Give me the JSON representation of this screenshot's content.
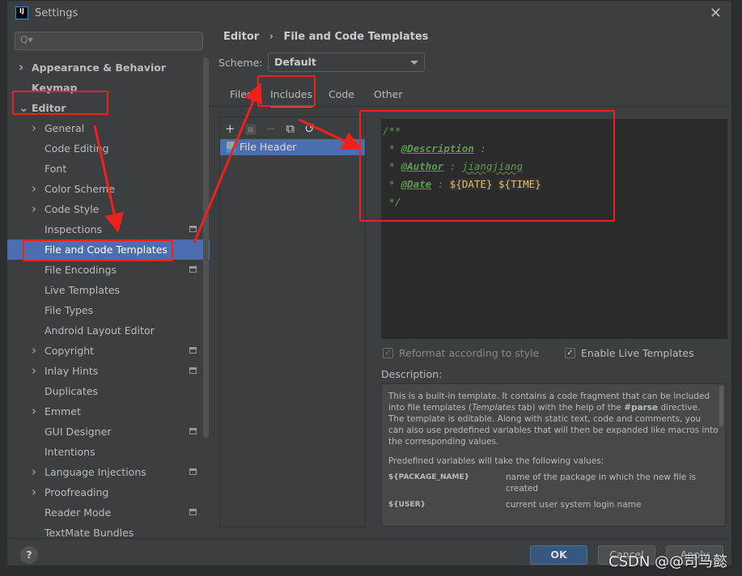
{
  "window": {
    "title": "Settings"
  },
  "search": {
    "placeholder": "Q▾"
  },
  "sidebar": {
    "items": [
      {
        "label": "Appearance & Behavior",
        "arrow": ">",
        "bold": true,
        "level": 0
      },
      {
        "label": "Keymap",
        "bold": true,
        "level": 0
      },
      {
        "label": "Editor",
        "arrow": "v",
        "bold": true,
        "level": 0
      },
      {
        "label": "General",
        "arrow": ">",
        "level": 1
      },
      {
        "label": "Code Editing",
        "level": 1
      },
      {
        "label": "Font",
        "level": 1
      },
      {
        "label": "Color Scheme",
        "arrow": ">",
        "level": 1
      },
      {
        "label": "Code Style",
        "arrow": ">",
        "level": 1
      },
      {
        "label": "Inspections",
        "level": 1,
        "badge": true
      },
      {
        "label": "File and Code Templates",
        "level": 1,
        "selected": true
      },
      {
        "label": "File Encodings",
        "level": 1,
        "badge": true
      },
      {
        "label": "Live Templates",
        "level": 1
      },
      {
        "label": "File Types",
        "level": 1
      },
      {
        "label": "Android Layout Editor",
        "level": 1
      },
      {
        "label": "Copyright",
        "arrow": ">",
        "level": 1,
        "badge": true
      },
      {
        "label": "Inlay Hints",
        "arrow": ">",
        "level": 1,
        "badge": true
      },
      {
        "label": "Duplicates",
        "level": 1
      },
      {
        "label": "Emmet",
        "arrow": ">",
        "level": 1
      },
      {
        "label": "GUI Designer",
        "level": 1,
        "badge": true
      },
      {
        "label": "Intentions",
        "level": 1
      },
      {
        "label": "Language Injections",
        "arrow": ">",
        "level": 1,
        "badge": true
      },
      {
        "label": "Proofreading",
        "arrow": ">",
        "level": 1
      },
      {
        "label": "Reader Mode",
        "level": 1,
        "badge": true
      },
      {
        "label": "TextMate Bundles",
        "level": 1
      }
    ]
  },
  "breadcrumb": {
    "parent": "Editor",
    "sep": "›",
    "current": "File and Code Templates"
  },
  "scheme": {
    "label": "Scheme:",
    "value": "Default"
  },
  "tabs": [
    {
      "label": "Files"
    },
    {
      "label": "Includes",
      "active": true
    },
    {
      "label": "Code"
    },
    {
      "label": "Other"
    }
  ],
  "toolbar": {
    "add": "+",
    "copy_icon": "copy-icon",
    "remove": "−",
    "reset": "↺"
  },
  "templates": [
    {
      "name": "File Header"
    }
  ],
  "editor": {
    "lines": {
      "l1": "/**",
      "star": " * ",
      "desc_tag": "@Description",
      "desc_rest": " :",
      "author_tag": "@Author",
      "author_sep": " : ",
      "author_val": "jiangjiang",
      "date_tag": "@Date",
      "date_sep": " : ",
      "var1": "${DATE}",
      "var2": "${TIME}",
      "end": " */"
    }
  },
  "options": {
    "reformat": "Reformat according to style",
    "reformat_checked": true,
    "reformat_disabled": true,
    "live": "Enable Live Templates",
    "live_checked": true
  },
  "description": {
    "label": "Description:",
    "p1a": "This is a built-in template. It contains a code fragment that can be included into file templates (",
    "p1i": "Templates",
    "p1b": " tab) with the help of the ",
    "p1c": "#parse",
    "p1d": " directive.",
    "p2": "The template is editable. Along with static text, code and comments, you can also use predefined variables that will then be expanded like macros into the corresponding values.",
    "p3": "Predefined variables will take the following values:",
    "vars": [
      {
        "key": "${PACKAGE_NAME}",
        "value": "name of the package in which the new file is created"
      },
      {
        "key": "${USER}",
        "value": "current user system login name"
      }
    ]
  },
  "footer": {
    "help": "?",
    "ok": "OK",
    "cancel": "Cancel",
    "apply": "Apply"
  },
  "watermark": "CSDN @@司马懿",
  "colors": {
    "accent": "#4b6eaf",
    "annotation": "#f0201c",
    "comment": "#629755",
    "bg": "#3c3f41",
    "editor_bg": "#2b2b2b"
  }
}
